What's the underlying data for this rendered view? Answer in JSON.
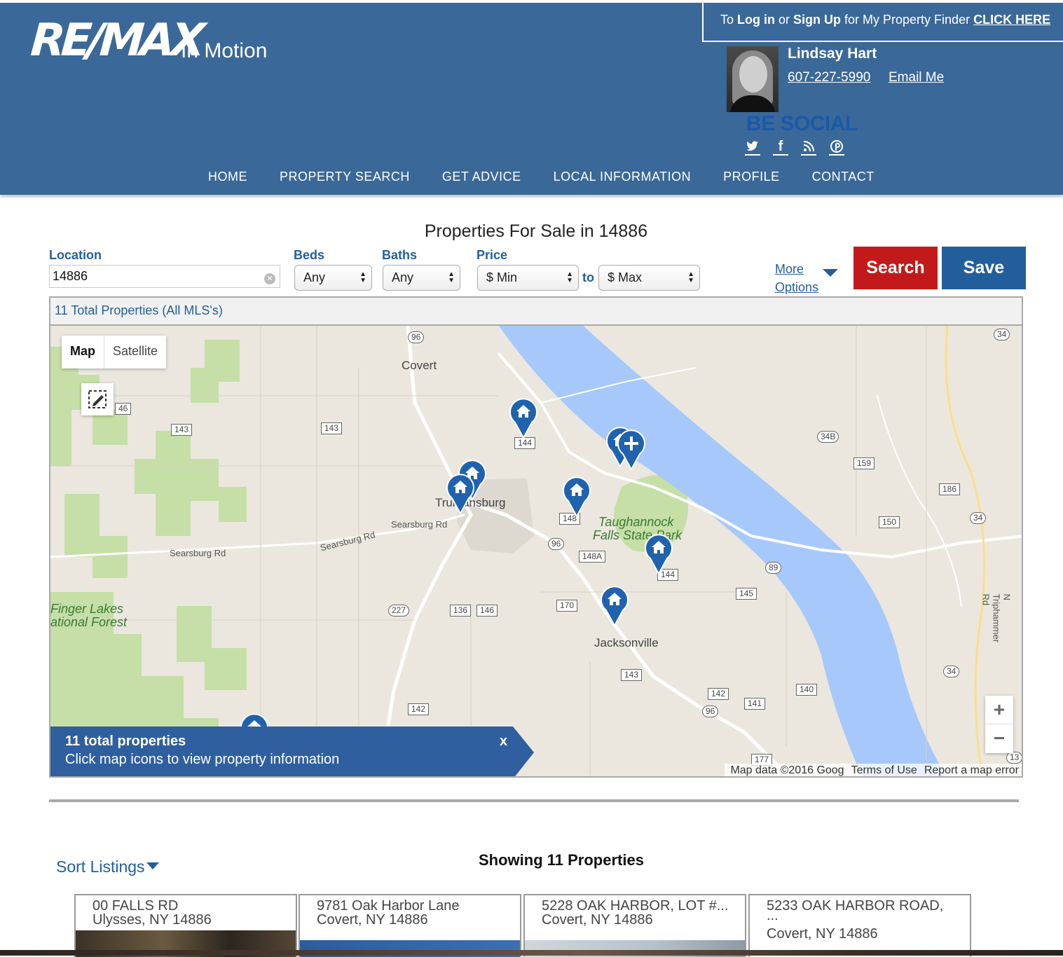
{
  "brand": {
    "logo_text": "RE/MAX",
    "logo_sub": "In Motion"
  },
  "login": {
    "prefix": "To ",
    "log_in": "Log in",
    "or": " or ",
    "sign_up": "Sign Up",
    "suffix": " for My Property Finder ",
    "click_here": "CLICK HERE"
  },
  "agent": {
    "name": "Lindsay Hart",
    "phone": "607-227-5990",
    "email_label": "Email Me",
    "social_heading": "BE SOCIAL",
    "social_icons": [
      "twitter-icon",
      "facebook-icon",
      "rss-icon",
      "pinterest-icon"
    ]
  },
  "nav": [
    "HOME",
    "PROPERTY SEARCH",
    "GET ADVICE",
    "LOCAL INFORMATION",
    "PROFILE",
    "CONTACT"
  ],
  "search": {
    "title": "Properties For Sale in 14886",
    "location_label": "Location",
    "location_value": "14886",
    "beds_label": "Beds",
    "beds_value": "Any",
    "baths_label": "Baths",
    "baths_value": "Any",
    "price_label": "Price",
    "price_min": "$ Min",
    "price_to": "to",
    "price_max": "$ Max",
    "more_options_line1": "More",
    "more_options_line2": "Options",
    "search_button": "Search",
    "save_button": "Save"
  },
  "colors": {
    "header_bg": "#3a6898",
    "brand_blue": "#235e9c",
    "search_red": "#c21a1a",
    "water": "#a6c8fb",
    "park_green": "#c5dfa6"
  },
  "map": {
    "total_bar": "11 Total Properties (All MLS's)",
    "type_map": "Map",
    "type_satellite": "Satellite",
    "places": [
      "Covert",
      "Trumansburg",
      "Jacksonville",
      "Taughannock",
      "Falls State Park",
      "Finger Lakes",
      "ational Forest"
    ],
    "roads": [
      "Searsburg Rd",
      "Searsburg Rd",
      "Searsburg Rd",
      "N Triphammer Rd"
    ],
    "route_shields": [
      "96",
      "46",
      "143",
      "143",
      "144",
      "34B",
      "159",
      "186",
      "34",
      "150",
      "148",
      "96",
      "148A",
      "89",
      "144",
      "145",
      "227",
      "136",
      "146",
      "170",
      "143",
      "34",
      "142",
      "140",
      "141",
      "96",
      "142",
      "177",
      "13",
      "34"
    ],
    "info_title": "11 total properties",
    "info_sub": "Click map icons to view property information",
    "info_close": "x",
    "attribution": [
      "Map data ©2016 Goog",
      "Terms of Use",
      "Report a map error"
    ],
    "zoom_in": "+",
    "zoom_out": "−"
  },
  "results": {
    "sort_label": "Sort Listings",
    "showing": "Showing 11 Properties",
    "cards": [
      {
        "line1": "00 FALLS RD",
        "line2": "Ulysses, NY 14886"
      },
      {
        "line1": "9781 Oak Harbor Lane",
        "line2": "Covert, NY 14886"
      },
      {
        "line1": "5228 OAK HARBOR, LOT #...",
        "line2": "Covert, NY 14886"
      },
      {
        "line1": "5233 OAK HARBOR ROAD,",
        "line2": "...",
        "line3": "Covert, NY 14886"
      }
    ]
  }
}
